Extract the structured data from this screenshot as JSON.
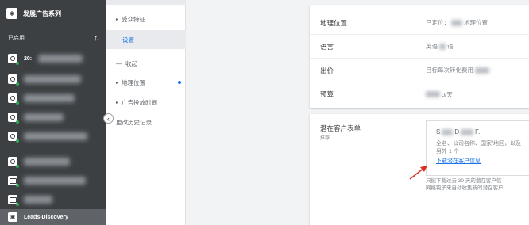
{
  "sidebar": {
    "header_title": "发展广告系列",
    "enabled_label": "已启用",
    "first_item_prefix": "20:",
    "active_item_label": "Leads-Discovery"
  },
  "subnav": {
    "audience": "受众特征",
    "settings": "设置",
    "collapse": "收起",
    "geo": "地理位置",
    "schedule": "广告投放时间",
    "history": "更改历史记录"
  },
  "settings_card": {
    "rows": [
      {
        "key": "地理位置",
        "value_prefix": "已定位：",
        "value_suffix": "地理位置"
      },
      {
        "key": "语言",
        "value_prefix": "英语",
        "value_suffix": "语"
      },
      {
        "key": "出价",
        "value_prefix": "目标每次转化费用",
        "value_suffix": ""
      },
      {
        "key": "预算",
        "value_prefix": "",
        "value_suffix": "0/天"
      }
    ]
  },
  "lead_card": {
    "title": "潜在客户表单",
    "subtitle": "推荐",
    "line1_prefix": "S",
    "line1_mid": "D",
    "line1_suffix": "F.",
    "fields": "全名、公司名称、国家/地区，以及另外 1 个",
    "download_link": "下载潜在客户信息",
    "note_line1": "只能下载过去 30 天的潜在客户信",
    "note_line2": "网络钩子来自动收集新的潜在客户"
  },
  "colors": {
    "sidebar_bg": "#3c4043",
    "accent_blue": "#1a73e8",
    "arrow_red": "#d93025"
  }
}
